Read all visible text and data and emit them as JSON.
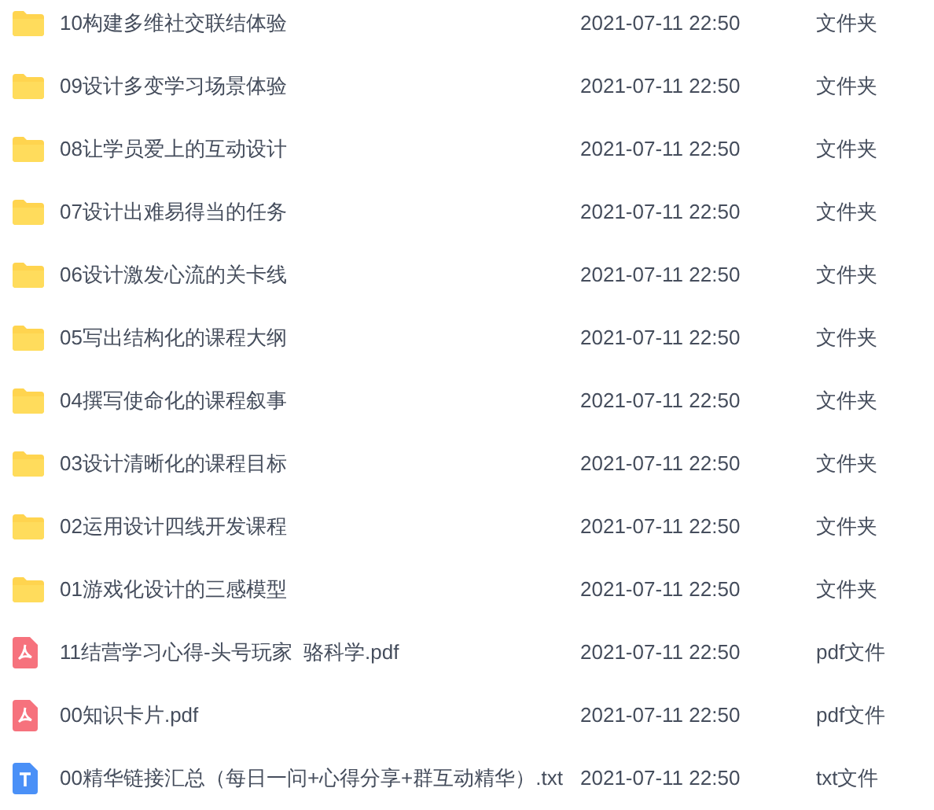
{
  "files": [
    {
      "kind": "folder",
      "name": "10构建多维社交联结体验",
      "date": "2021-07-11 22:50",
      "type": "文件夹"
    },
    {
      "kind": "folder",
      "name": "09设计多变学习场景体验",
      "date": "2021-07-11 22:50",
      "type": "文件夹"
    },
    {
      "kind": "folder",
      "name": "08让学员爱上的互动设计",
      "date": "2021-07-11 22:50",
      "type": "文件夹"
    },
    {
      "kind": "folder",
      "name": "07设计出难易得当的任务",
      "date": "2021-07-11 22:50",
      "type": "文件夹"
    },
    {
      "kind": "folder",
      "name": "06设计激发心流的关卡线",
      "date": "2021-07-11 22:50",
      "type": "文件夹"
    },
    {
      "kind": "folder",
      "name": "05写出结构化的课程大纲",
      "date": "2021-07-11 22:50",
      "type": "文件夹"
    },
    {
      "kind": "folder",
      "name": "04撰写使命化的课程叙事",
      "date": "2021-07-11 22:50",
      "type": "文件夹"
    },
    {
      "kind": "folder",
      "name": "03设计清晰化的课程目标",
      "date": "2021-07-11 22:50",
      "type": "文件夹"
    },
    {
      "kind": "folder",
      "name": "02运用设计四线开发课程",
      "date": "2021-07-11 22:50",
      "type": "文件夹"
    },
    {
      "kind": "folder",
      "name": "01游戏化设计的三感模型",
      "date": "2021-07-11 22:50",
      "type": "文件夹"
    },
    {
      "kind": "pdf",
      "name": "11结营学习心得-头号玩家  骆科学.pdf",
      "date": "2021-07-11 22:50",
      "type": "pdf文件"
    },
    {
      "kind": "pdf",
      "name": "00知识卡片.pdf",
      "date": "2021-07-11 22:50",
      "type": "pdf文件"
    },
    {
      "kind": "txt",
      "name": "00精华链接汇总（每日一问+心得分享+群互动精华）.txt",
      "date": "2021-07-11 22:50",
      "type": "txt文件"
    }
  ]
}
